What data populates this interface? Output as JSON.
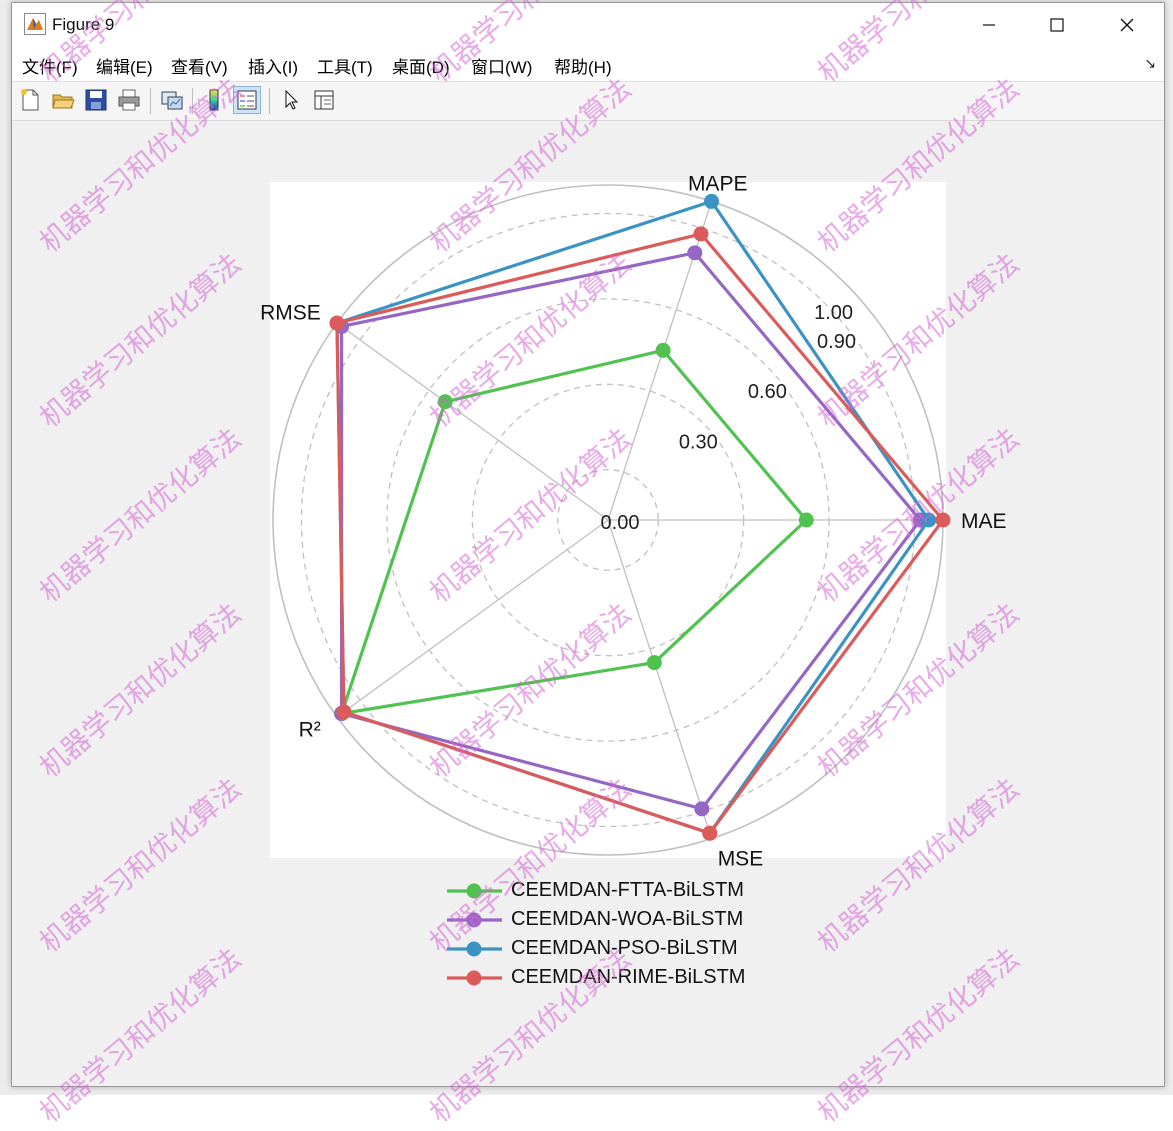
{
  "window": {
    "title": "Figure 9"
  },
  "menu": [
    "文件(F)",
    "编辑(E)",
    "查看(V)",
    "插入(I)",
    "工具(T)",
    "桌面(D)",
    "窗口(W)",
    "帮助(H)"
  ],
  "toolbar": [
    "new-figure-icon",
    "open-file-icon",
    "save-icon",
    "print-icon",
    "link-plot-icon",
    "colorbar-icon",
    "legend-icon",
    "pointer-icon",
    "property-inspector-icon"
  ],
  "chart_data": {
    "type": "radar",
    "axes": [
      "MAE",
      "MAPE",
      "RMSE",
      "R²",
      "MSE"
    ],
    "r_ticks": [
      "0.00",
      "0.30",
      "0.60",
      "0.90",
      "1.00"
    ],
    "r_tick_values": [
      0,
      0.3,
      0.6,
      0.9,
      1.0
    ],
    "rlim": [
      0,
      1
    ],
    "grid": true,
    "legend_position": "bottom",
    "series": [
      {
        "name": "CEEMDAN-FTTA-BiLSTM",
        "color": "#4fc24f",
        "values": [
          0.52,
          0.45,
          0.53,
          0.98,
          0.35
        ]
      },
      {
        "name": "CEEMDAN-WOA-BiLSTM",
        "color": "#9467c4",
        "values": [
          0.92,
          0.81,
          0.98,
          0.98,
          0.89
        ]
      },
      {
        "name": "CEEMDAN-PSO-BiLSTM",
        "color": "#3b93c3",
        "values": [
          0.95,
          1.0,
          1.0,
          0.97,
          0.98
        ]
      },
      {
        "name": "CEEMDAN-RIME-BiLSTM",
        "color": "#db5b5b",
        "values": [
          1.0,
          0.88,
          1.0,
          0.97,
          0.98
        ]
      }
    ]
  },
  "watermark": "机器学习和优化算法"
}
